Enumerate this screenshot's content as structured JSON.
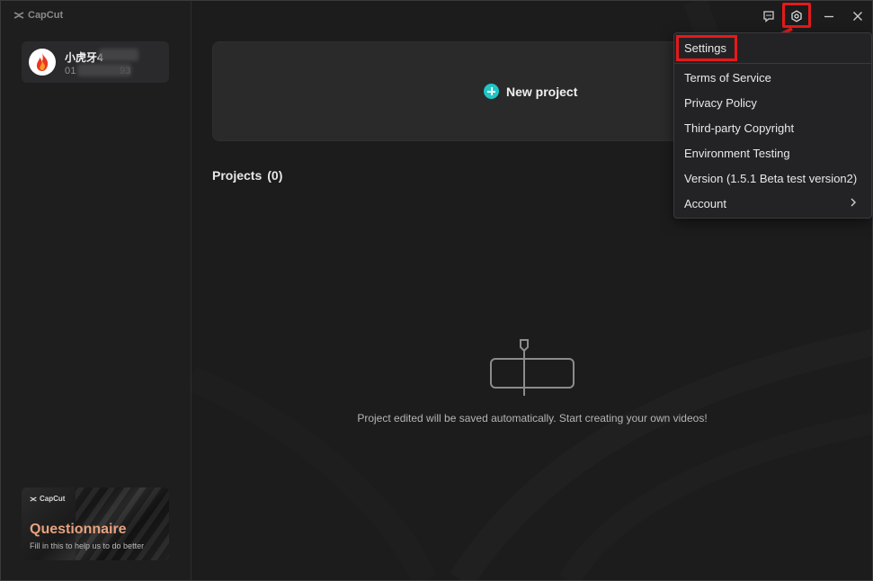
{
  "app": {
    "logo_text": "CapCut"
  },
  "user": {
    "name": "小虎牙4",
    "id_prefix": "01",
    "id_suffix": "93"
  },
  "main": {
    "new_project_label": "New project",
    "projects_label": "Projects",
    "projects_count": "(0)",
    "empty_message": "Project edited will be saved automatically. Start creating your own videos!"
  },
  "questionnaire": {
    "logo_text": "CapCut",
    "title": "Questionnaire",
    "subtitle": "Fill in this to help us to do better"
  },
  "menu": {
    "settings": "Settings",
    "terms": "Terms of Service",
    "privacy": "Privacy Policy",
    "third_party": "Third-party Copyright",
    "environment": "Environment Testing",
    "version": "Version (1.5.1 Beta test version2)",
    "account": "Account"
  },
  "icons": {
    "feedback": "feedback-icon",
    "settings": "gear-icon",
    "minimize": "minimize-icon",
    "close": "close-icon",
    "account_chevron": "chevron-right-icon"
  },
  "colors": {
    "accent": "#1fc6c6",
    "highlight": "#e6191b",
    "questionnaire_title": "#e8a27e"
  }
}
